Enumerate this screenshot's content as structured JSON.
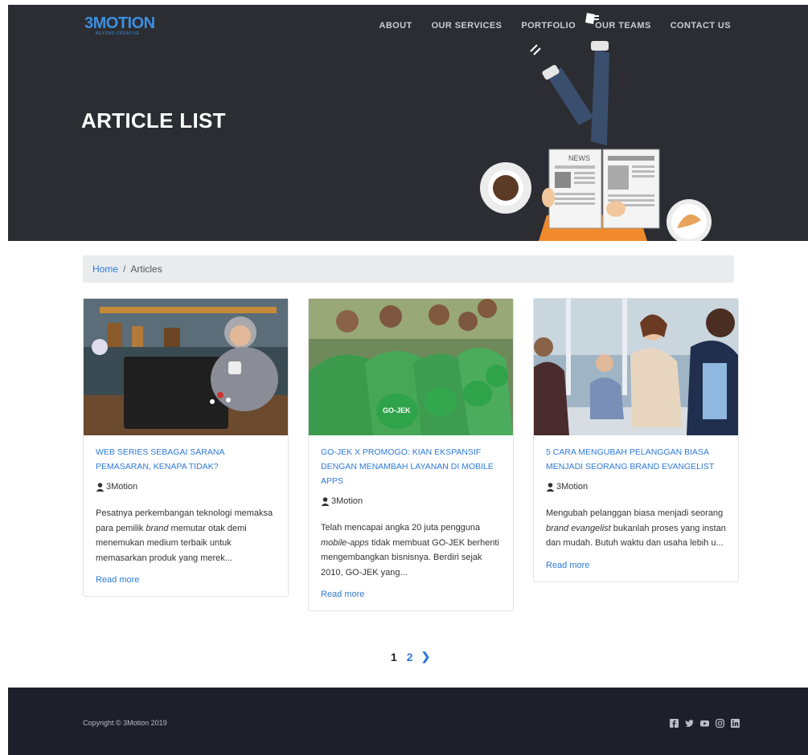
{
  "brand": {
    "logo_text": "3MOTION",
    "tagline": "BEYOND CREATIVE"
  },
  "nav": {
    "items": [
      {
        "label": "ABOUT"
      },
      {
        "label": "OUR SERVICES"
      },
      {
        "label": "PORTFOLIO"
      },
      {
        "label": "OUR TEAMS"
      },
      {
        "label": "CONTACT US"
      }
    ]
  },
  "hero": {
    "title": "ARTICLE LIST",
    "newspaper_text": "NEWS"
  },
  "breadcrumb": {
    "home": "Home",
    "separator": "/",
    "current": "Articles"
  },
  "articles": [
    {
      "title": "WEB SERIES SEBAGAI SARANA PEMASARAN, KENAPA TIDAK?",
      "author": "3Motion",
      "excerpt_a": "Pesatnya perkembangan teknologi memaksa para pemilik ",
      "excerpt_em": "brand",
      "excerpt_b": " memutar otak demi menemukan medium terbaik untuk memasarkan produk yang merek...",
      "read_more": "Read more"
    },
    {
      "title": "GO-JEK X PROMOGO: KIAN EKSPANSIF DENGAN MENAMBAH LAYANAN DI MOBILE APPS",
      "author": "3Motion",
      "excerpt_a": "Telah mencapai angka 20 juta pengguna ",
      "excerpt_em": "mobile-apps",
      "excerpt_b": " tidak membuat GO-JEK berhenti mengembangkan bisnisnya. Berdiri sejak 2010, GO-JEK yang...",
      "read_more": "Read more",
      "helmet_text": "GO-JEK"
    },
    {
      "title": "5 CARA MENGUBAH PELANGGAN BIASA MENJADI SEORANG BRAND EVANGELIST",
      "author": "3Motion",
      "excerpt_a": "Mengubah pelanggan biasa menjadi seorang ",
      "excerpt_em": "brand evangelist",
      "excerpt_b": " bukanlah proses yang instan dan mudah. Butuh waktu dan usaha lebih u...",
      "read_more": "Read more"
    }
  ],
  "pagination": {
    "current": "1",
    "next_page": "2",
    "next_arrow": "❯"
  },
  "footer": {
    "copyright": "Copyright © 3Motion 2019",
    "social_icons": [
      "facebook-icon",
      "twitter-icon",
      "youtube-icon",
      "instagram-icon",
      "linkedin-icon"
    ]
  },
  "colors": {
    "hero_bg": "#2b2d32",
    "accent": "#2f7ad8",
    "footer_bg": "#1f1f2b",
    "breadcrumb_bg": "#e9ecef"
  }
}
